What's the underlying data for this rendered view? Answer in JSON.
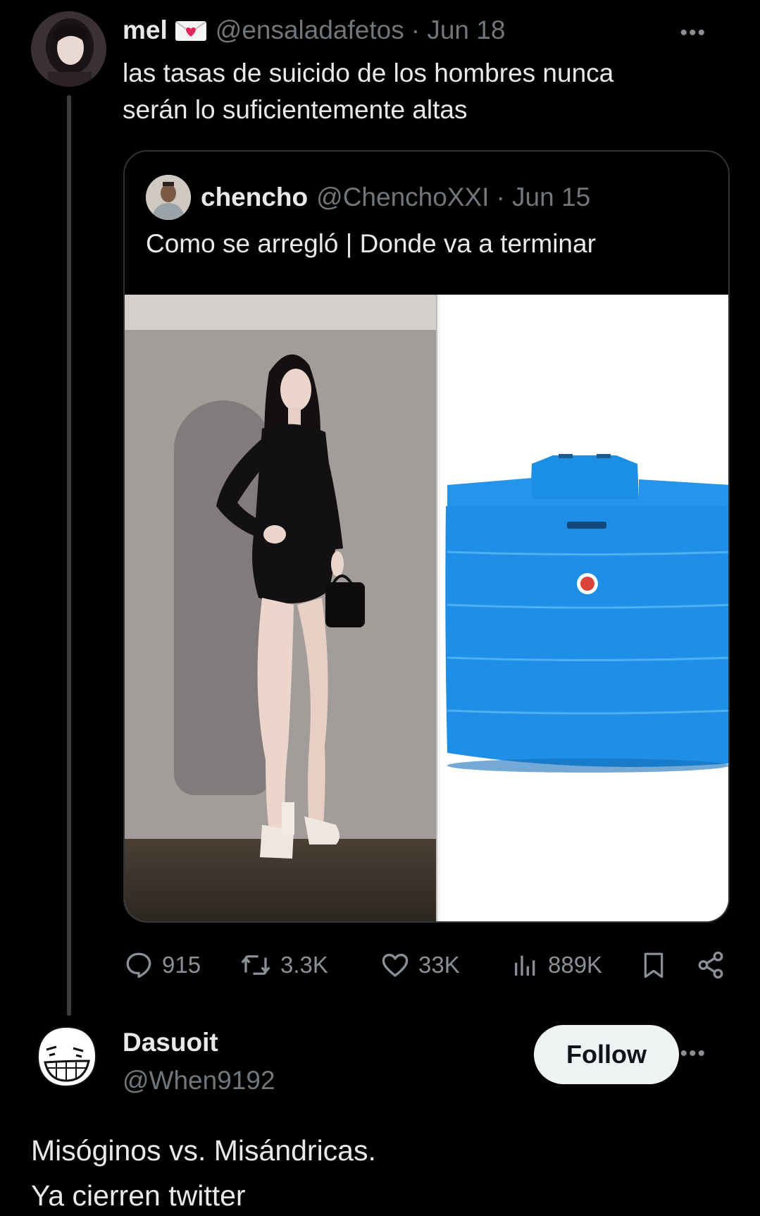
{
  "top_tweet": {
    "author_name": "mel",
    "author_handle": "@ensaladafetos",
    "date": "· Jun 18",
    "text_line1": "las tasas de suicido de los hombres nunca",
    "text_line2": "serán lo suficientemente altas",
    "more": "•••"
  },
  "quote": {
    "author_name": "chencho",
    "author_handle": "@ChenchoXXI",
    "date": "· Jun 15",
    "text": "Como se arregló | Donde va a terminar"
  },
  "stats": {
    "replies": "915",
    "reposts": "3.3K",
    "likes": "33K",
    "views": "889K",
    "icons": [
      "reply-icon",
      "repost-icon",
      "like-icon",
      "views-icon",
      "bookmark-icon",
      "share-icon"
    ]
  },
  "reply": {
    "author_name": "Dasuoit",
    "author_handle": "@When9192",
    "follow_label": "Follow",
    "more": "•••",
    "text_line1": "Misóginos vs. Misándricas.",
    "text_line2": "Ya cierren twitter"
  },
  "colors": {
    "background": "#000000",
    "text": "#e7e9ea",
    "muted": "#71767b",
    "tank_blue": "#1f8fe6"
  }
}
